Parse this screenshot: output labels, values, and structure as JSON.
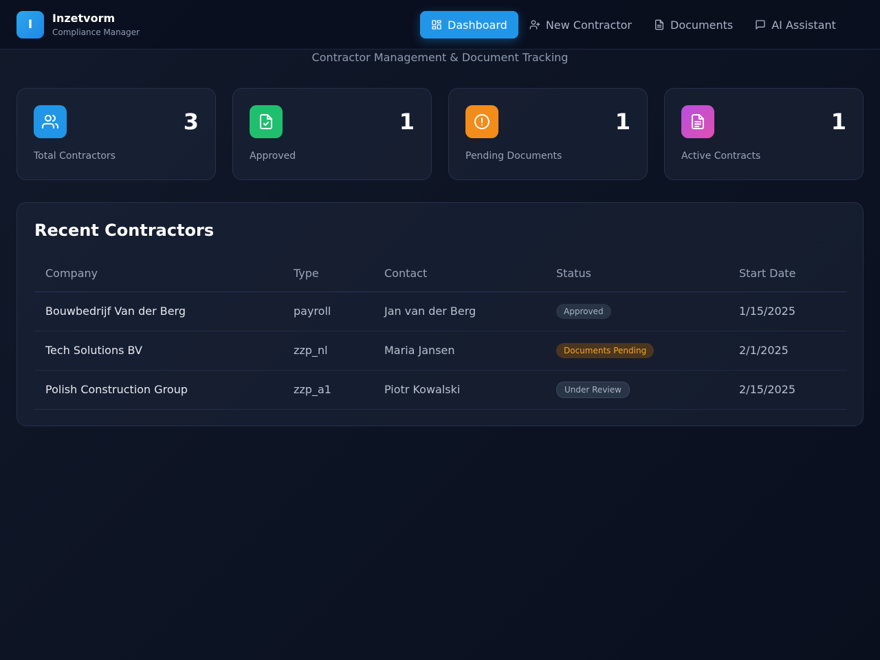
{
  "brand": {
    "logo_letter": "I",
    "name": "Inzetvorm",
    "subtitle": "Compliance Manager"
  },
  "nav": {
    "items": [
      {
        "label": "Dashboard",
        "icon": "dashboard-icon",
        "active": true
      },
      {
        "label": "New Contractor",
        "icon": "user-plus-icon",
        "active": false
      },
      {
        "label": "Documents",
        "icon": "document-icon",
        "active": false
      },
      {
        "label": "AI Assistant",
        "icon": "chat-icon",
        "active": false
      }
    ]
  },
  "hero": {
    "subtitle": "Contractor Management & Document Tracking"
  },
  "stats": [
    {
      "value": "3",
      "label": "Total Contractors",
      "icon": "users-icon",
      "color": "#2196e8"
    },
    {
      "value": "1",
      "label": "Approved",
      "icon": "file-check-icon",
      "color": "#1fbf6e"
    },
    {
      "value": "1",
      "label": "Pending Documents",
      "icon": "alert-circle-icon",
      "color": "#f28c1b"
    },
    {
      "value": "1",
      "label": "Active Contracts",
      "icon": "file-text-icon",
      "color": "#c64fd6"
    }
  ],
  "recent": {
    "title": "Recent Contractors",
    "columns": [
      "Company",
      "Type",
      "Contact",
      "Status",
      "Start Date"
    ],
    "rows": [
      {
        "company": "Bouwbedrijf Van der Berg",
        "type": "payroll",
        "contact": "Jan van der Berg",
        "status": "Approved",
        "status_kind": "approved",
        "start": "1/15/2025"
      },
      {
        "company": "Tech Solutions BV",
        "type": "zzp_nl",
        "contact": "Maria Jansen",
        "status": "Documents Pending",
        "status_kind": "pending",
        "start": "2/1/2025"
      },
      {
        "company": "Polish Construction Group",
        "type": "zzp_a1",
        "contact": "Piotr Kowalski",
        "status": "Under Review",
        "status_kind": "review",
        "start": "2/15/2025"
      }
    ]
  }
}
